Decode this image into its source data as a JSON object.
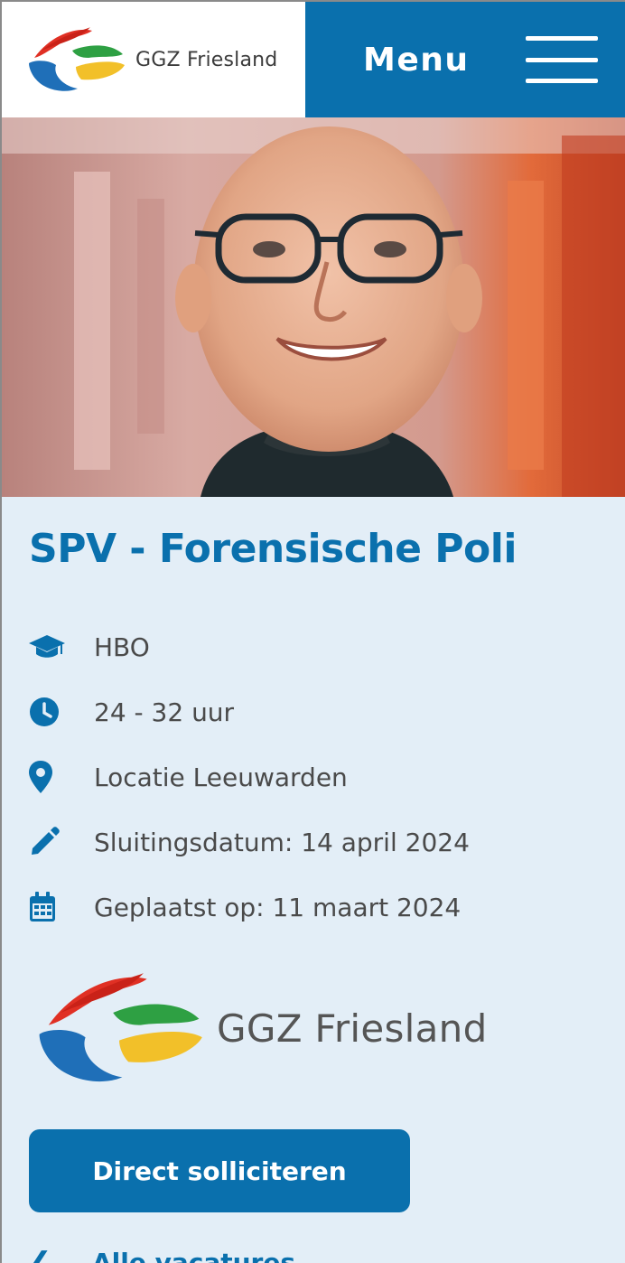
{
  "header": {
    "brand_name": "GGZ Friesland",
    "menu_label": "Menu",
    "colors": {
      "primary": "#0a70ad",
      "brand_red": "#e03024",
      "brand_green": "#2ea043",
      "brand_yellow": "#f2c029",
      "brand_blue": "#1f6fb8"
    }
  },
  "hero": {
    "alt": "Portret van een man met bril in een gang"
  },
  "vacancy": {
    "title": "SPV - Forensische Poli",
    "facts": [
      {
        "icon": "graduation-cap-icon",
        "text": "HBO"
      },
      {
        "icon": "clock-icon",
        "text": "24 - 32 uur"
      },
      {
        "icon": "location-pin-icon",
        "text": "Locatie Leeuwarden"
      },
      {
        "icon": "pencil-icon",
        "text": "Sluitingsdatum: 14 april 2024"
      },
      {
        "icon": "calendar-icon",
        "text": "Geplaatst op: 11 maart 2024"
      }
    ],
    "employer_logo_text": "GGZ Friesland",
    "apply_label": "Direct solliciteren",
    "back_label": "Alle vacatures"
  }
}
